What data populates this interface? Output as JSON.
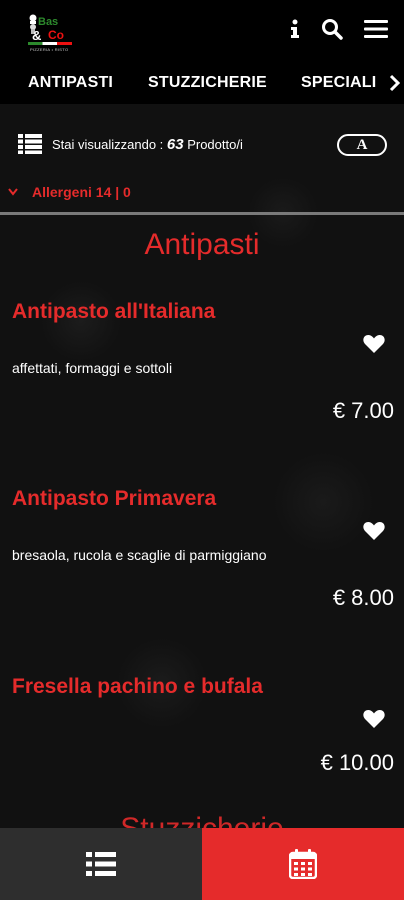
{
  "header": {
    "logo": {
      "line1": "Bas",
      "line2": "&",
      "line3": "Co",
      "subtitle": "PIZZERIA • RISTO"
    },
    "icons": [
      "info-icon",
      "search-icon",
      "menu-icon"
    ]
  },
  "tabs": [
    {
      "label": "ANTIPASTI"
    },
    {
      "label": "STUZZICHERIE"
    },
    {
      "label": "SPECIALI"
    }
  ],
  "info": {
    "prefix": "Stai visualizzando : ",
    "count": "63",
    "suffix": " Prodotto/i",
    "letter_button": "A"
  },
  "allergeni": {
    "label": "Allergeni 14 | 0"
  },
  "category": {
    "title": "Antipasti",
    "next_title": "Stuzzicherie"
  },
  "items": [
    {
      "name": "Antipasto all'Italiana",
      "desc": "affettati, formaggi e sottoli",
      "price": "€ 7.00"
    },
    {
      "name": "Antipasto Primavera",
      "desc": "bresaola, rucola e scaglie di parmiggiano",
      "price": "€ 8.00"
    },
    {
      "name": "Fresella pachino e bufala",
      "desc": "",
      "price": "€ 10.00"
    }
  ],
  "colors": {
    "accent": "#e52b2b",
    "background": "#000000",
    "bottom_left": "#2e2e2e"
  },
  "bottom_bar": {
    "left_icon": "list-icon",
    "right_icon": "calendar-icon"
  }
}
